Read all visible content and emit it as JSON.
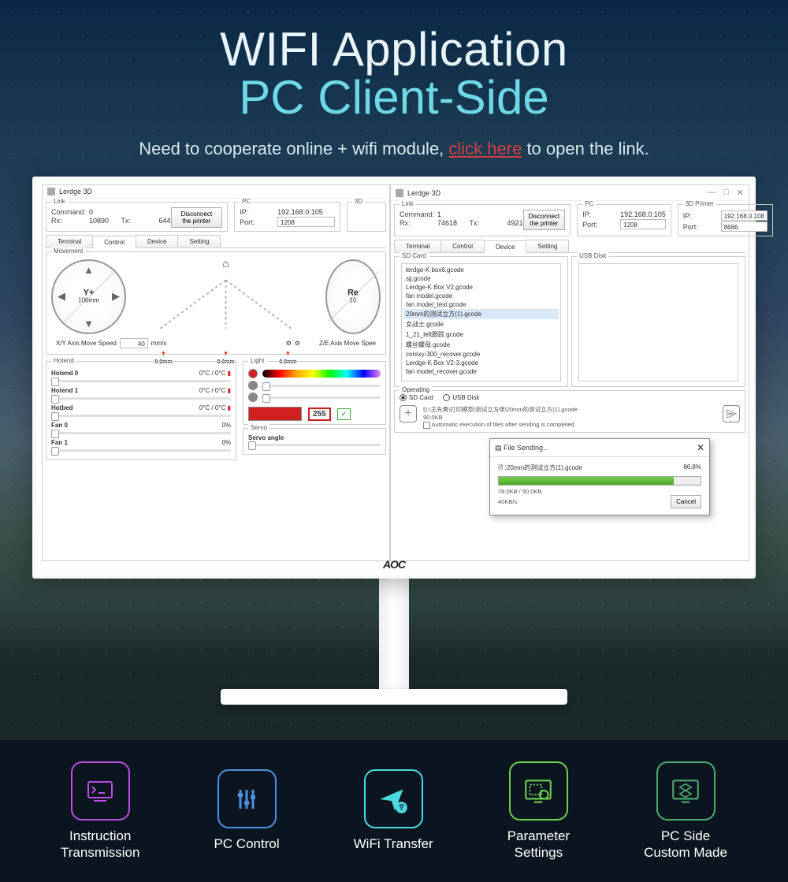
{
  "hero": {
    "title1": "WIFI Application",
    "title2": "PC Client-Side",
    "subtitle_a": "Need to cooperate online + wifi module, ",
    "subtitle_link": "click here",
    "subtitle_b": " to open the link."
  },
  "monitor_brand": "AOC",
  "win1": {
    "title": "Lerdge 3D",
    "link": {
      "legend": "Link",
      "command_label": "Command:",
      "command": "0",
      "rx_label": "Rx:",
      "rx": "10890",
      "tx_label": "Tx:",
      "tx": "644",
      "disconnect": "Disconnect the printer"
    },
    "pc": {
      "legend": "PC",
      "ip_label": "IP:",
      "ip": "192.168.0.105",
      "port_label": "Port:",
      "port": "1208"
    },
    "printer": {
      "legend": "3D"
    },
    "tabs": [
      "Terminal",
      "Control",
      "Device",
      "Setting"
    ],
    "active_tab": 1,
    "movement": {
      "legend": "Movement",
      "center_axis": "Y+",
      "center_val": "100mm",
      "pos": [
        "0.0mm",
        "0.0mm",
        "0.0mm"
      ],
      "speed_label": "X/Y Axis Move Speed",
      "speed": "40",
      "speed_unit": "mm/s",
      "z_label": "Z/E Axis Move Spee",
      "re_label": "Re",
      "re_val": "10"
    },
    "hotend": {
      "legend": "Hotend",
      "rows": [
        [
          "Hotend 0",
          "0°C / 0°C"
        ],
        [
          "Hotend 1",
          "0°C / 0°C"
        ],
        [
          "Hotbed",
          "0°C / 0°C"
        ],
        [
          "Fan 0",
          "0%"
        ],
        [
          "Fan 1",
          "0%"
        ]
      ]
    },
    "light": {
      "legend": "Light",
      "value": "255"
    },
    "servo": {
      "legend": "Servo",
      "label": "Servo angle"
    }
  },
  "win2": {
    "title": "Lerdge 3D",
    "link": {
      "legend": "Link",
      "command_label": "Command:",
      "command": "1",
      "rx_label": "Rx:",
      "rx": "74618",
      "tx_label": "Tx:",
      "tx": "4921",
      "disconnect": "Disconnect the printer"
    },
    "pc": {
      "legend": "PC",
      "ip_label": "IP:",
      "ip": "192.168.0.105",
      "port_label": "Port:",
      "port": "1208"
    },
    "printer": {
      "legend": "3D Printer",
      "ip_label": "IP:",
      "ip": "192.168.0.108",
      "port_label": "Port:",
      "port": "8686"
    },
    "tabs": [
      "Terminal",
      "Control",
      "Device",
      "Setting"
    ],
    "active_tab": 2,
    "sd": {
      "legend": "SD Card",
      "files": [
        "lerdge-K box6.gcode",
        "sjj.gcode",
        "Lerdge-K Box V2.gcode",
        "fan model.gcode",
        "fan model_test.gcode",
        "20mm的测试立方(1).gcode",
        "女战士.gcode",
        "1_21_left跟踪.gcode",
        "螺丝螺母.gcode",
        "corexy-300_recover.gcode",
        "Lerdge-K Box V2-3.gcode",
        "fan model_recover.gcode"
      ],
      "selected": 5
    },
    "usb": {
      "legend": "USB Disk"
    },
    "dialog": {
      "title": "File Sending...",
      "filename": ":20mm的测试立方(1).gcode",
      "percent": "86.8%",
      "progress": 86.8,
      "sizes": "78.0KB / 90.0KB",
      "speed": "40KB/s",
      "cancel": "Cancel"
    },
    "oper": {
      "legend": "Operating",
      "radio_sd": "SD Card",
      "radio_usb": "USB Disk",
      "path": "D:\\王先勇\\打印模型\\测试立方体\\20mm的测试立方(1).gcode",
      "size": "90.0KB",
      "auto": "Automatic execution of files after sending is completed"
    }
  },
  "features": [
    {
      "label1": "Instruction",
      "label2": "Transmission"
    },
    {
      "label1": "PC Control",
      "label2": ""
    },
    {
      "label1": "WiFi Transfer",
      "label2": ""
    },
    {
      "label1": "Parameter",
      "label2": "Settings"
    },
    {
      "label1": "PC Side",
      "label2": "Custom Made"
    }
  ]
}
